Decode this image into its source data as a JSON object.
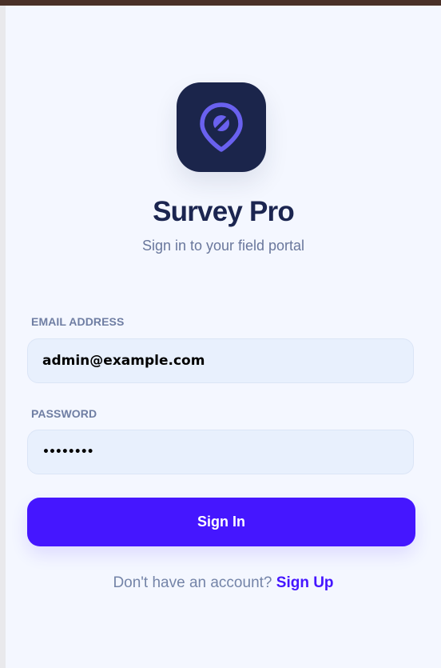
{
  "app": {
    "title": "Survey Pro",
    "subtitle": "Sign in to your field portal",
    "logo_icon": "location-pin-icon"
  },
  "form": {
    "email_label": "EMAIL ADDRESS",
    "email_value": "admin@example.com",
    "password_label": "PASSWORD",
    "password_value": "••••••••",
    "submit_label": "Sign In"
  },
  "footer": {
    "prompt": "Don't have an account?",
    "signup_label": "Sign Up"
  },
  "colors": {
    "brand": "#1b254b",
    "accent": "#4516ff",
    "field_bg": "#e8f0fd",
    "page_bg": "#f4f7ff"
  }
}
